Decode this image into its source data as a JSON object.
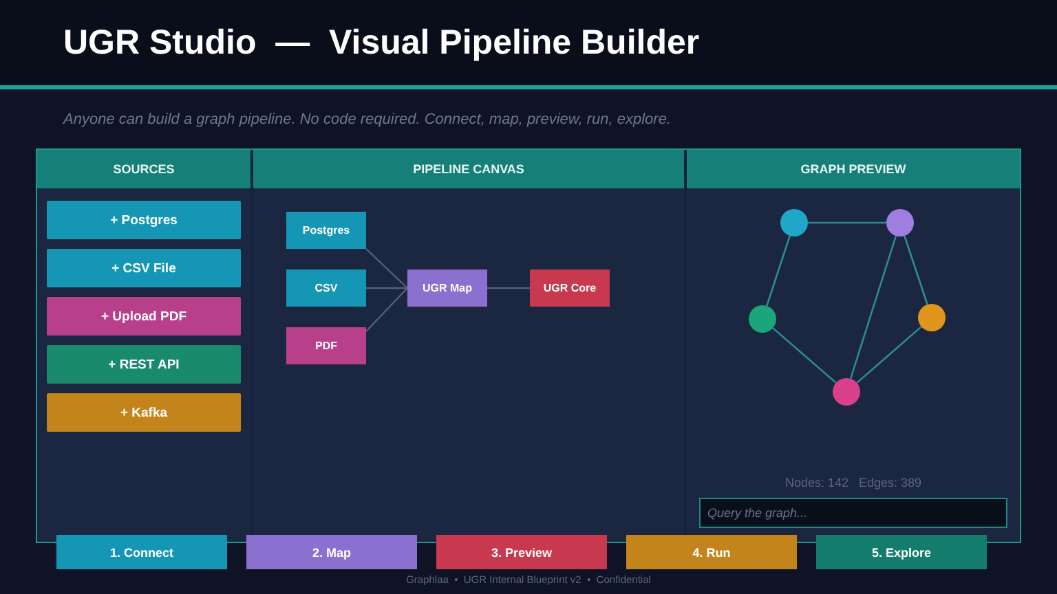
{
  "header": {
    "title": "UGR Studio  —  Visual Pipeline Builder"
  },
  "subtitle": "Anyone can build a graph pipeline. No code required. Connect, map, preview, run, explore.",
  "sources": {
    "heading": "SOURCES",
    "items": [
      {
        "label": "+ Postgres",
        "color": "#1596b4"
      },
      {
        "label": "+ CSV File",
        "color": "#1596b4"
      },
      {
        "label": "+ Upload PDF",
        "color": "#b8408a"
      },
      {
        "label": "+ REST API",
        "color": "#1a8a6c"
      },
      {
        "label": "+ Kafka",
        "color": "#c4841c"
      }
    ]
  },
  "canvas": {
    "heading": "PIPELINE CANVAS",
    "nodes": [
      {
        "label": "Postgres",
        "color": "#1596b4"
      },
      {
        "label": "CSV",
        "color": "#1596b4"
      },
      {
        "label": "PDF",
        "color": "#b8408a"
      },
      {
        "label": "UGR Map",
        "color": "#8b70d0"
      },
      {
        "label": "UGR Core",
        "color": "#c8384f"
      }
    ]
  },
  "graph_preview": {
    "heading": "GRAPH PREVIEW",
    "nodes": [
      {
        "color": "#1ea7c9"
      },
      {
        "color": "#a07de0"
      },
      {
        "color": "#1aa57a"
      },
      {
        "color": "#e0961c"
      },
      {
        "color": "#d8408a"
      }
    ],
    "stats": "Nodes: 142   Edges: 389",
    "query": {
      "placeholder": "Query the graph..."
    }
  },
  "steps": [
    {
      "label": "1. Connect",
      "color": "#1596b4"
    },
    {
      "label": "2. Map",
      "color": "#8b70d0"
    },
    {
      "label": "3. Preview",
      "color": "#c8384f"
    },
    {
      "label": "4. Run",
      "color": "#c4841c"
    },
    {
      "label": "5. Explore",
      "color": "#147c6c"
    }
  ],
  "footer": "Graphlaa  •  UGR Internal Blueprint v2  •  Confidential"
}
